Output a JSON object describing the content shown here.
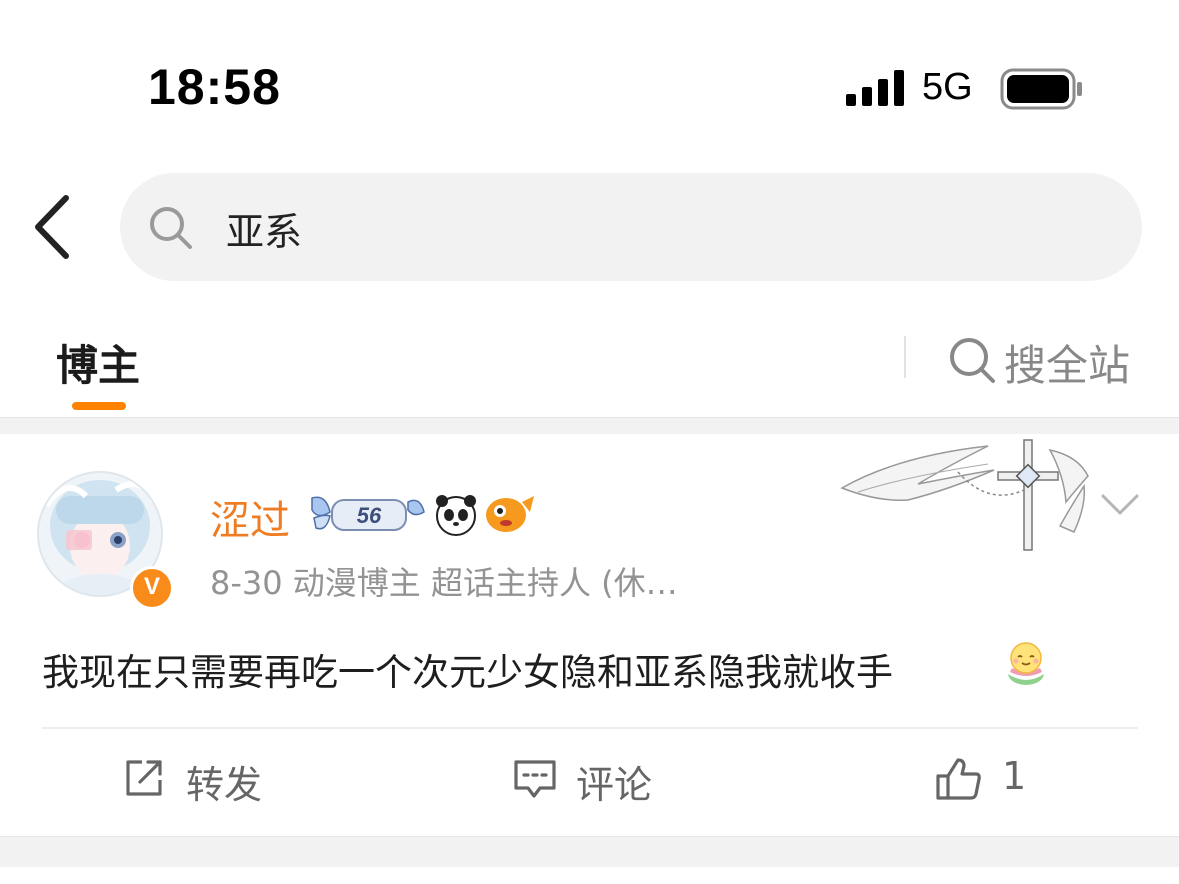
{
  "status_bar": {
    "time": "18:58",
    "network": "5G",
    "signal_icon": "cellular-signal-icon",
    "battery_icon": "battery-icon"
  },
  "search": {
    "back_icon": "chevron-left-icon",
    "search_icon": "search-icon",
    "query": "亚系"
  },
  "tabs": {
    "active_label": "博主",
    "active_color": "#ff8200",
    "search_all_label": "搜全站",
    "search_all_icon": "search-icon"
  },
  "post": {
    "username": "涩过",
    "username_color": "#f07c22",
    "verified_badge": "V",
    "badges": [
      "butterfly-level-56-icon",
      "panda-icon",
      "fish-icon"
    ],
    "badge_level": "56",
    "meta": "8-30  动漫博主 超话主持人 (休…",
    "decoration_icon": "winged-cross-icon",
    "more_icon": "chevron-down-icon",
    "text": "我现在只需要再吃一个次元少女隐和亚系隐我就收手",
    "emoji_icon": "pray-emoji-icon",
    "actions": {
      "repost_label": "转发",
      "comment_label": "评论",
      "like_count": "1"
    }
  }
}
